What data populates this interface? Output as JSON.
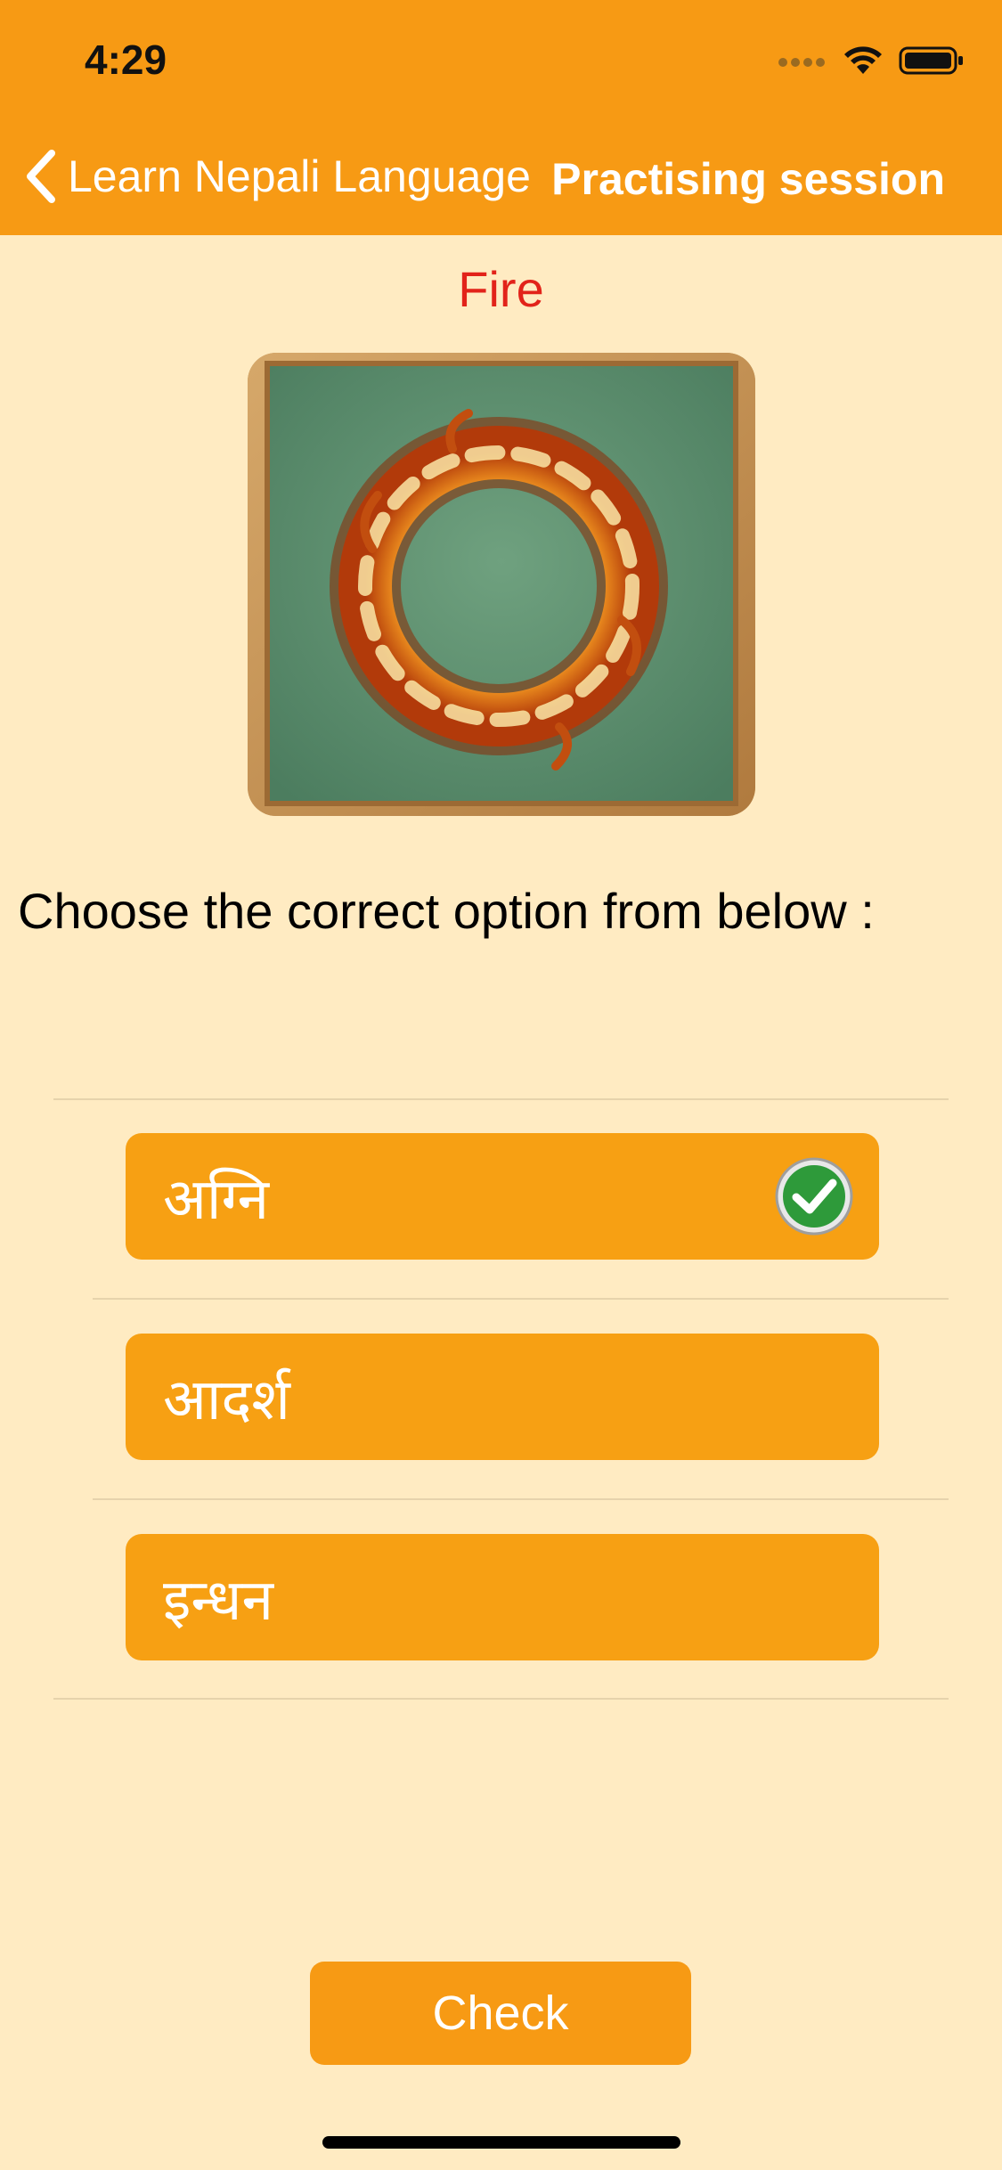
{
  "status_bar": {
    "time": "4:29"
  },
  "nav": {
    "back_label": "Learn Nepali Language",
    "title": "Practising session"
  },
  "question": {
    "word": "Fire",
    "prompt": "Choose the correct option from below :"
  },
  "options": [
    {
      "label": "अग्नि",
      "selected": true
    },
    {
      "label": "आदर्श",
      "selected": false
    },
    {
      "label": "इन्धन",
      "selected": false
    }
  ],
  "check_button": {
    "label": "Check"
  },
  "colors": {
    "accent": "#F79A14",
    "background": "#FFEBC2",
    "word": "#E2231A",
    "option": "#F7A013"
  }
}
